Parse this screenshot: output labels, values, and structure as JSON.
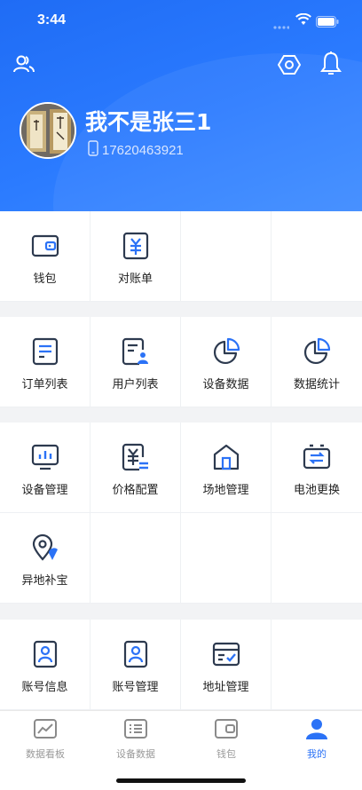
{
  "status_bar": {
    "time": "3:44"
  },
  "profile": {
    "name": "我不是张三1",
    "phone": "17620463921"
  },
  "sections": [
    {
      "items": [
        {
          "label": "钱包",
          "icon": "wallet-icon"
        },
        {
          "label": "对账单",
          "icon": "statement-icon"
        }
      ]
    },
    {
      "items": [
        {
          "label": "订单列表",
          "icon": "order-list-icon"
        },
        {
          "label": "用户列表",
          "icon": "user-list-icon"
        },
        {
          "label": "设备数据",
          "icon": "pie-chart-icon"
        },
        {
          "label": "数据统计",
          "icon": "pie-chart-icon"
        }
      ]
    },
    {
      "items": [
        {
          "label": "设备管理",
          "icon": "monitor-chart-icon"
        },
        {
          "label": "价格配置",
          "icon": "price-config-icon"
        },
        {
          "label": "场地管理",
          "icon": "house-icon"
        },
        {
          "label": "电池更换",
          "icon": "battery-swap-icon"
        },
        {
          "label": "异地补宝",
          "icon": "location-pin-icon"
        }
      ]
    },
    {
      "items": [
        {
          "label": "账号信息",
          "icon": "account-icon"
        },
        {
          "label": "账号管理",
          "icon": "account-icon"
        },
        {
          "label": "地址管理",
          "icon": "address-icon"
        }
      ]
    }
  ],
  "tabs": [
    {
      "label": "数据看板",
      "icon": "dashboard-icon"
    },
    {
      "label": "设备数据",
      "icon": "device-data-icon"
    },
    {
      "label": "钱包",
      "icon": "wallet-icon"
    },
    {
      "label": "我的",
      "icon": "person-icon",
      "active": true
    }
  ],
  "colors": {
    "primary": "#2b72f6",
    "icon_dark": "#2d3a4f",
    "icon_accent": "#2b72f6",
    "background": "#f2f3f5"
  }
}
